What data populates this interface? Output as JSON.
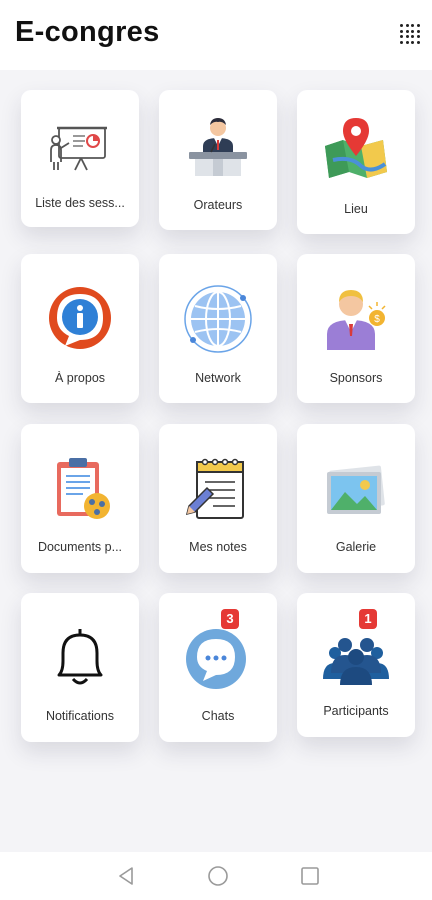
{
  "app": {
    "title": "E-congres"
  },
  "colors": {
    "background": "#f4f4f7",
    "card": "#ffffff",
    "badge": "#e53935",
    "text": "#333333"
  },
  "menu_icon": "apps-grid-icon",
  "tiles": [
    {
      "label": "Liste des sess...",
      "icon": "presentation-board-icon"
    },
    {
      "label": "Orateurs",
      "icon": "speaker-podium-icon"
    },
    {
      "label": "Lieu",
      "icon": "map-location-icon"
    },
    {
      "label": "À propos",
      "icon": "info-icon"
    },
    {
      "label": "Network",
      "icon": "globe-network-icon"
    },
    {
      "label": "Sponsors",
      "icon": "sponsor-person-icon"
    },
    {
      "label": "Documents p...",
      "icon": "clipboard-documents-icon"
    },
    {
      "label": "Mes notes",
      "icon": "notepad-pencil-icon"
    },
    {
      "label": "Galerie",
      "icon": "photo-gallery-icon"
    },
    {
      "label": "Notifications",
      "icon": "bell-icon"
    },
    {
      "label": "Chats",
      "icon": "chat-bubble-icon",
      "badge": "3"
    },
    {
      "label": "Participants",
      "icon": "people-group-icon",
      "badge": "1"
    }
  ],
  "nav": {
    "back": "back-triangle-icon",
    "home": "home-circle-icon",
    "recents": "recents-square-icon"
  }
}
